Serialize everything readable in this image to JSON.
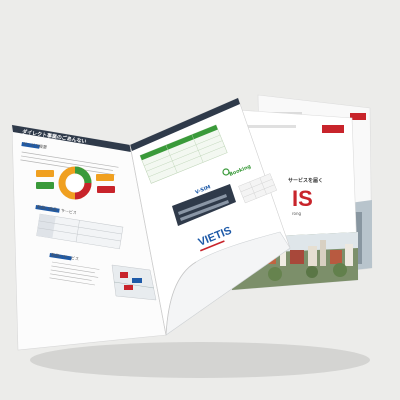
{
  "brochure": {
    "left_page": {
      "header_title": "ダイレクト事業のごあんない",
      "section_label_1": "サービス概要",
      "section_label_2": "取扱い商品・サービス",
      "section_label_3": "取扱いサービス"
    },
    "right_page": {
      "brand_logo": "VIETIS",
      "partner_logo_a": "V-SIM",
      "partner_logo_b": "Booking"
    },
    "back_sheets": {
      "tagline": "サービスを届く",
      "brand_fragment": "IS",
      "brand_sub": "rong"
    }
  },
  "colors": {
    "background": "#ececea",
    "accent_red": "#c8242b",
    "accent_blue": "#1e5aa8",
    "accent_green": "#3a9a3a",
    "accent_orange": "#f0a020",
    "panel_dark": "#2f3a4a"
  }
}
